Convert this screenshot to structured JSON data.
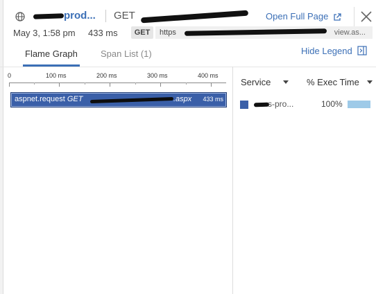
{
  "header": {
    "service_short": "prod...",
    "method": "GET",
    "open_full_page": "Open Full Page"
  },
  "meta": {
    "date": "May 3, 1:58 pm",
    "duration": "433 ms",
    "method_badge": "GET",
    "url_prefix": "https",
    "url_suffix": "view.as..."
  },
  "tabs": {
    "flame_graph": "Flame Graph",
    "span_list": "Span List (1)",
    "hide_legend": "Hide Legend"
  },
  "axis": {
    "ticks": [
      "0",
      "100 ms",
      "200 ms",
      "300 ms",
      "400 ms"
    ]
  },
  "span": {
    "name": "aspnet.request",
    "method": "GET",
    "resource_suffix": ".aspx",
    "duration": "433 ms",
    "color": "#3a5fa8"
  },
  "legend": {
    "service_header": "Service",
    "exec_header": "% Exec Time",
    "row": {
      "service": "s-pro...",
      "pct": "100%",
      "pct_value": 100,
      "swatch_color": "#3a5fa8",
      "bar_color": "#9ecae8"
    }
  }
}
